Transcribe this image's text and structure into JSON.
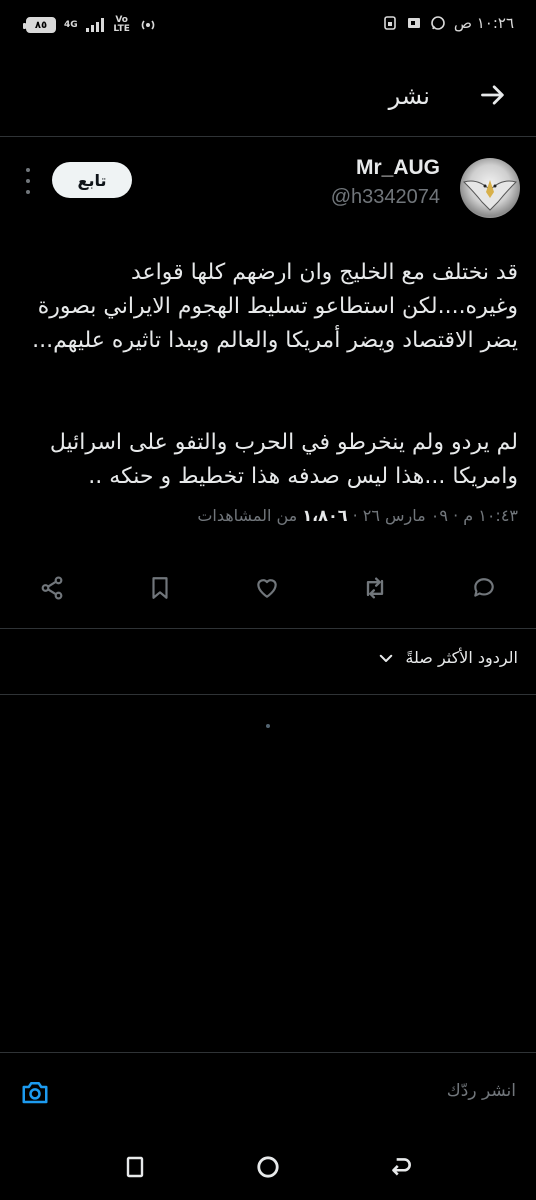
{
  "status_bar": {
    "time": "١٠:٢٦ ص",
    "battery": "٨٥",
    "network_top": "4G",
    "network_volte": "Vo LTE"
  },
  "header": {
    "title": "نشر",
    "back_icon": "arrow-right-icon"
  },
  "tweet": {
    "display_name": "Mr_AUG",
    "handle": "@h3342074",
    "follow_label": "تابع",
    "paragraphs": [
      "قد نختلف مع الخليج وان ارضهم كلها قواعد وغيره....لكن استطاعو تسليط الهجوم الايراني بصورة يضر الاقتصاد ويضر أمريكا والعالم ويبدا تاثيره عليهم...",
      "لم يردو ولم ينخرطو في الحرب والتفو على اسرائيل وامريكا ...هذا ليس صدفه هذا تخطيط و حنكه .."
    ],
    "timestamp": "١٠:٤٣ م · ٠٩ مارس ٢٦ ·",
    "views_count": "١،٨٠٦",
    "views_label": "من المشاهدات"
  },
  "actions": {
    "reply_icon": "reply-icon",
    "retweet_icon": "retweet-icon",
    "like_icon": "heart-icon",
    "bookmark_icon": "bookmark-icon",
    "share_icon": "share-icon"
  },
  "replies_sort": {
    "label": "الردود الأكثر صلةً"
  },
  "reply_bar": {
    "placeholder": "انشر ردّك"
  },
  "colors": {
    "background": "#000000",
    "text": "#e7e9ea",
    "muted": "#71767b",
    "accent": "#1d9bf0",
    "divider": "#2f3336"
  }
}
